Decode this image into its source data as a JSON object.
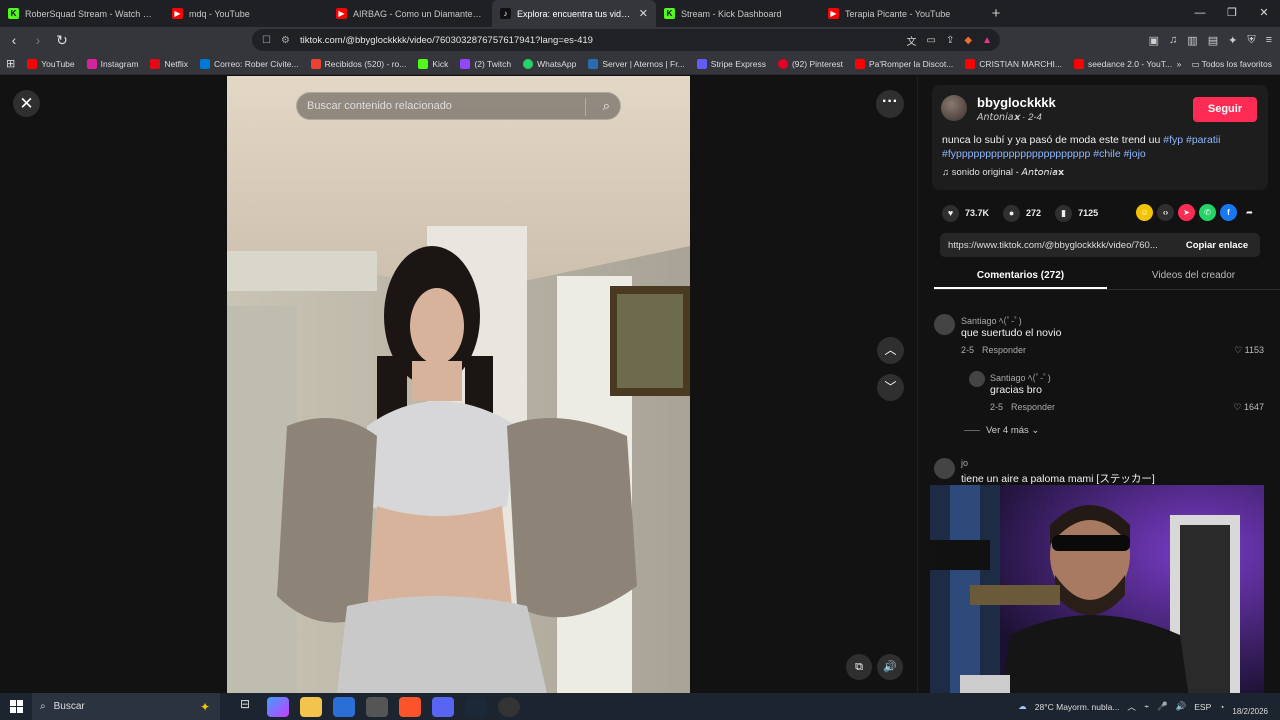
{
  "tabs": [
    {
      "title": "RoberSquad Stream - Watch Live",
      "favicon_color": "#53fc18",
      "glyph": "K",
      "active": false
    },
    {
      "title": "mdq - YouTube",
      "favicon_color": "#ff0000",
      "glyph": "▶",
      "active": false
    },
    {
      "title": "AIRBAG - Como un Diamante - video",
      "favicon_color": "#ff0000",
      "glyph": "▶",
      "active": false
    },
    {
      "title": "Explora: encuentra tus videos",
      "favicon_color": "#111111",
      "glyph": "♪",
      "active": true
    },
    {
      "title": "Stream - Kick Dashboard",
      "favicon_color": "#53fc18",
      "glyph": "K",
      "active": false
    },
    {
      "title": "Terapia Picante - YouTube",
      "favicon_color": "#ff0000",
      "glyph": "▶",
      "active": false
    }
  ],
  "browser": {
    "url": "tiktok.com/@bbyglockkkk/video/7603032876757617941?lang=es-419",
    "bookmarks": [
      {
        "label": "YouTube",
        "color": "#ff0000"
      },
      {
        "label": "Instagram",
        "color": "#d6249f"
      },
      {
        "label": "Netflix",
        "color": "#e50914"
      },
      {
        "label": "Correo: Rober Civite...",
        "color": "#0078d4"
      },
      {
        "label": "Recibidos (520) - ro...",
        "color": "#ea4335"
      },
      {
        "label": "Kick",
        "color": "#53fc18"
      },
      {
        "label": "(2) Twitch",
        "color": "#9146ff"
      },
      {
        "label": "WhatsApp",
        "color": "#25d366"
      },
      {
        "label": "Server | Aternos | Fr...",
        "color": "#2a6cb0"
      },
      {
        "label": "Stripe Express",
        "color": "#635bff"
      },
      {
        "label": "(92) Pinterest",
        "color": "#e60023"
      },
      {
        "label": "Pa'Romper la Discot...",
        "color": "#ff0000"
      },
      {
        "label": "CRISTIAN MARCHI...",
        "color": "#ff0000"
      },
      {
        "label": "seedance 2.0 - YouT...",
        "color": "#ff0000"
      }
    ],
    "all_bookmarks": "Todos los favoritos"
  },
  "viewer": {
    "search_placeholder": "Buscar contenido relacionado"
  },
  "post": {
    "username": "bbyglockkkk",
    "subline": "𝘈𝘯𝘵𝘰𝘯𝘪𝘢𝘅 · 2-4",
    "follow_label": "Seguir",
    "desc_text": "nunca lo subí y ya pasó de moda este trend uu ",
    "hashtags": "#fyp #paratii #fyppppppppppppppppppppppp #chile #jojo",
    "sound": "♫  sonido original - 𝘈𝘯𝘵𝘰𝘯𝘪𝘢𝘅",
    "likes": "73.7K",
    "comments": "272",
    "saves": "7125",
    "link": "https://www.tiktok.com/@bbyglockkkk/video/760...",
    "copy_label": "Copiar enlace"
  },
  "panel_tabs": {
    "comments": "Comentarios (272)",
    "creator_videos": "Videos del creador"
  },
  "comments": [
    {
      "name": "Santiago ﾍ(ﾟ-ﾟ)",
      "text": "que suertudo el novio",
      "date": "2-5",
      "reply": "Responder",
      "likes": "♡ 1153"
    },
    {
      "name": "Santiago ﾍ(ﾟ-ﾟ)",
      "text": "gracias bro",
      "date": "2-5",
      "reply": "Responder",
      "likes": "♡ 1647"
    },
    {
      "name": "jo",
      "text": "tiene un aire a paloma mami [ステッカー]",
      "date": "",
      "reply": "",
      "likes": ""
    }
  ],
  "more_replies": "Ver 4 más",
  "taskbar": {
    "search": "Buscar",
    "weather": "28°C  Mayorm. nubla...",
    "lang": "ESP",
    "date": "18/2/2026"
  }
}
